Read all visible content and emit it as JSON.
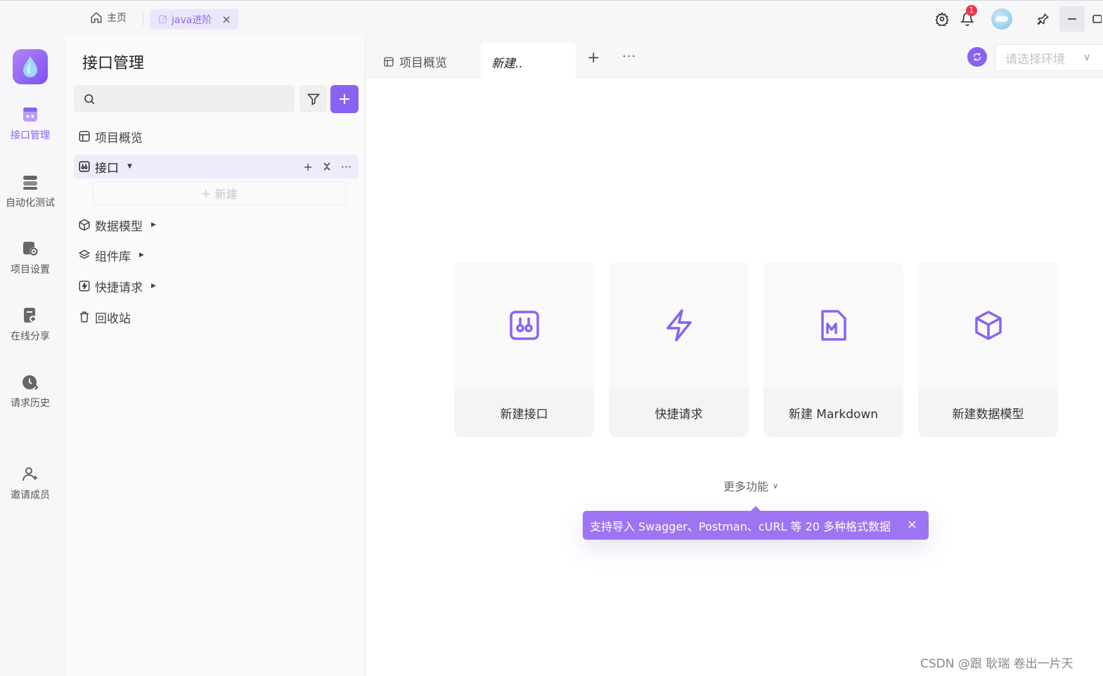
{
  "titlebar": {
    "home_label": "主页",
    "project_tab_label": "java进阶",
    "project_tab_close": "×",
    "notification_count": "1"
  },
  "rail": {
    "items": [
      {
        "label": "接口管理",
        "icon": "api-icon",
        "active": true
      },
      {
        "label": "自动化测试",
        "icon": "automation-icon",
        "active": false
      },
      {
        "label": "项目设置",
        "icon": "settings-icon",
        "active": false
      },
      {
        "label": "在线分享",
        "icon": "share-icon",
        "active": false
      },
      {
        "label": "请求历史",
        "icon": "history-icon",
        "active": false
      },
      {
        "label": "邀请成员",
        "icon": "invite-user-icon",
        "active": false
      }
    ]
  },
  "sidebar": {
    "title": "接口管理",
    "search_placeholder": "",
    "tree": [
      {
        "label": "项目概览",
        "icon": "layout-icon"
      },
      {
        "label": "接口",
        "icon": "api-icon"
      },
      {
        "label": "数据模型",
        "icon": "cube-icon"
      },
      {
        "label": "组件库",
        "icon": "layers-icon"
      },
      {
        "label": "快捷请求",
        "icon": "quick-request-icon"
      },
      {
        "label": "回收站",
        "icon": "trash-icon"
      }
    ],
    "new_label": "新建"
  },
  "main": {
    "tabs": {
      "overview_label": "项目概览",
      "new_tab_label": "新建..",
      "add": "+",
      "more": "···"
    },
    "env_placeholder": "请选择环境",
    "cards": [
      {
        "label": "新建接口",
        "icon": "api-icon"
      },
      {
        "label": "快捷请求",
        "icon": "lightning-icon"
      },
      {
        "label": "新建 Markdown",
        "icon": "markdown-icon"
      },
      {
        "label": "新建数据模型",
        "icon": "cube-icon"
      }
    ],
    "more_features": "更多功能",
    "tooltip": "支持导入 Swagger、Postman、cURL 等 20 多种格式数据",
    "tooltip_close": "×"
  },
  "watermark": "CSDN @跟 耿瑞 卷出一片天",
  "colors": {
    "accent": "#8a62f2",
    "tooltip_bg": "#9d75f2",
    "badge": "#f0354a"
  }
}
